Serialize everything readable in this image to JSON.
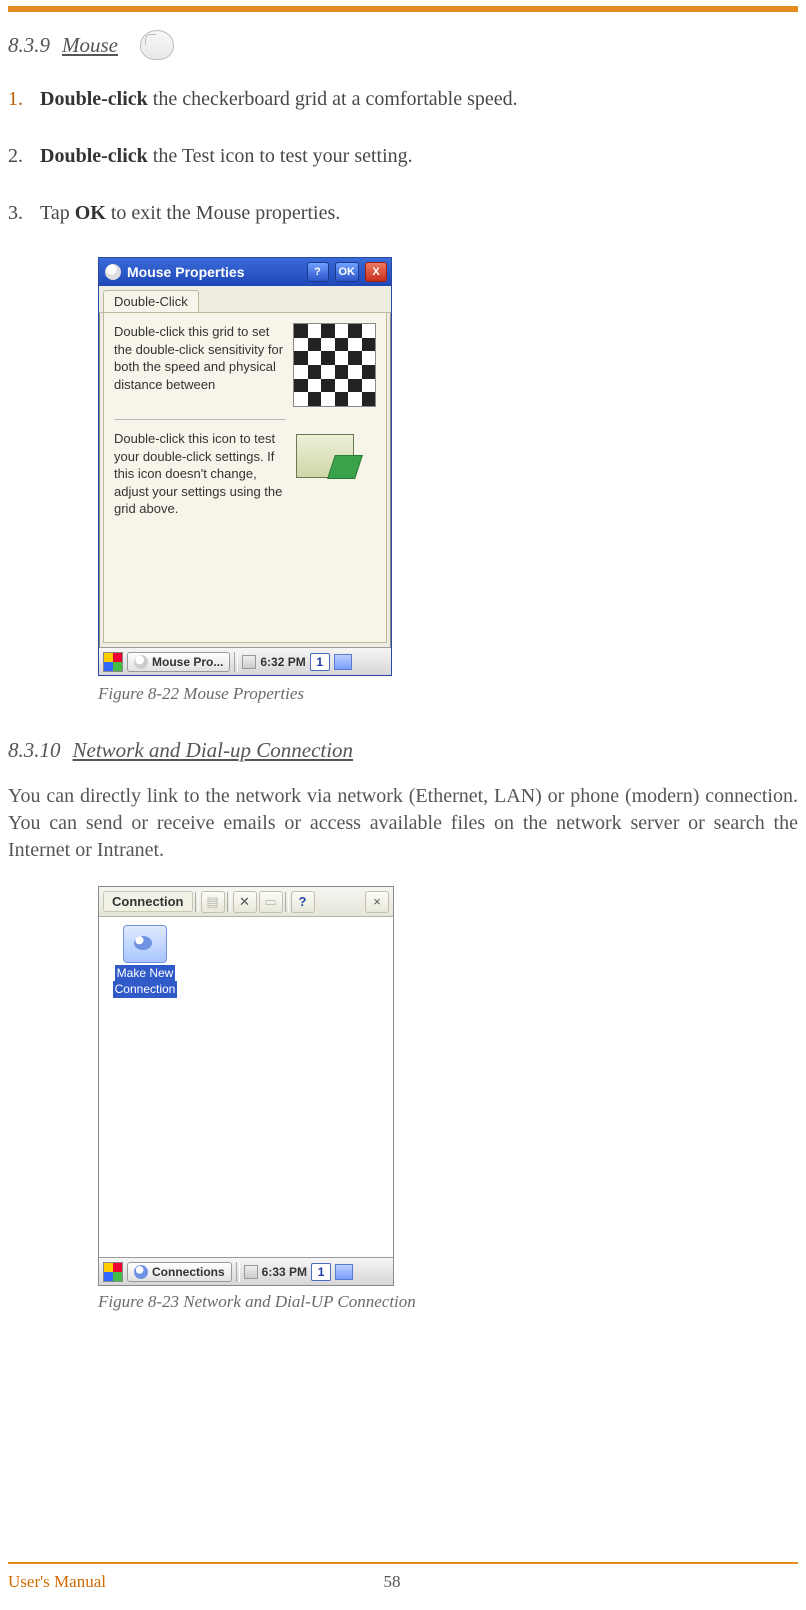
{
  "sections": {
    "mouse": {
      "num": "8.3.9",
      "title": "Mouse"
    },
    "net": {
      "num": "8.3.10",
      "title": "Network and Dial-up Connection"
    }
  },
  "steps": [
    {
      "bold": "Double-click",
      "text": " the checkerboard grid at a comfortable speed."
    },
    {
      "bold": "Double-click",
      "text": " the Test icon to test your setting."
    },
    {
      "pre": "Tap ",
      "bold": "OK",
      "text": " to exit the Mouse properties."
    }
  ],
  "mouseWin": {
    "title": "Mouse Properties",
    "help": "?",
    "ok": "OK",
    "close": "X",
    "tab": "Double-Click",
    "gridText": "Double-click this grid to set the double-click sensitivity for both the speed and physical distance between",
    "testText": "Double-click this icon to test your double-click settings. If this icon doesn't change, adjust your settings using the grid above.",
    "taskLabel": "Mouse Pro...",
    "time": "6:32 PM",
    "sip": "1"
  },
  "captions": {
    "fig1": "Figure 8-22 Mouse Properties",
    "fig2": "Figure 8-23 Network and Dial-UP Connection"
  },
  "netPara": "You can directly link to the network via network (Ethernet, LAN) or phone (modern) connection. You can send or receive emails or access available files on the network server or search the Internet or Intranet.",
  "connWin": {
    "title": "Connection",
    "itemLine1": "Make New",
    "itemLine2": "Connection",
    "help": "?",
    "close": "×",
    "del": "✕",
    "taskLabel": "Connections",
    "time": "6:33 PM",
    "sip": "1"
  },
  "footer": {
    "label": "User's Manual",
    "page": "58"
  }
}
